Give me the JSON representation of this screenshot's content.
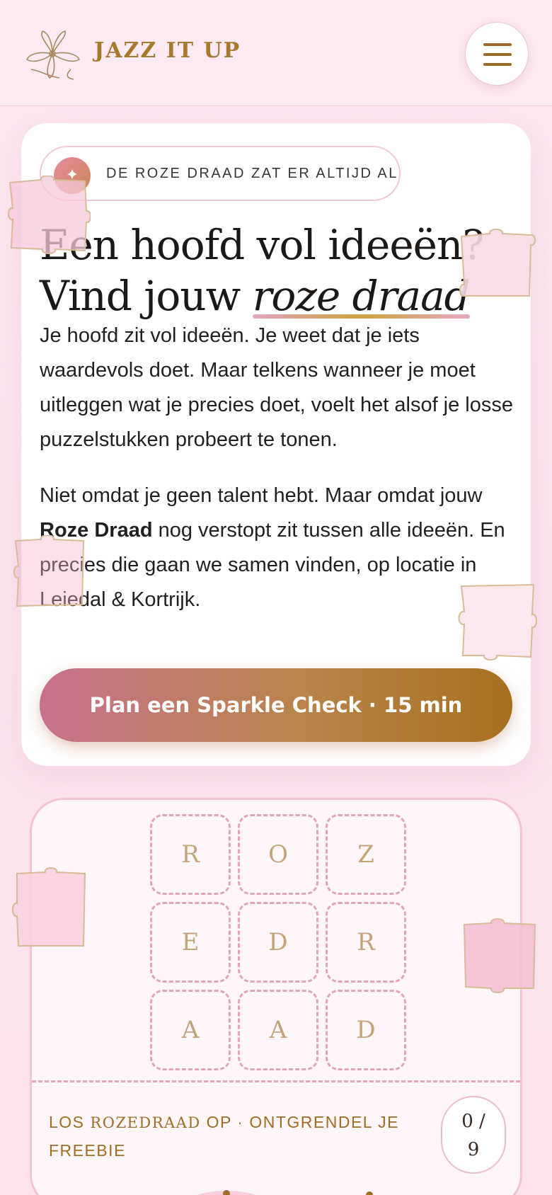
{
  "header": {
    "brand": "JAZZ IT UP",
    "menu_icon": "hamburger-menu-icon",
    "logo_icon": "flower-logo-icon"
  },
  "hero": {
    "pill_icon": "sparkle-icon",
    "pill_text": "DE ROZE DRAAD ZAT ER ALTIJD AL",
    "title_line1": "Een hoofd vol ideeën?",
    "title_line2_plain": "Vind jouw ",
    "title_line2_accent": "roze draad",
    "para1": "Je hoofd zit vol ideeën. Je weet dat je iets waardevols doet. Maar telkens wanneer je moet uitleggen wat je precies doet, voelt het alsof je losse puzzelstukken probeert te tonen.",
    "para2_before": "Niet omdat je geen talent hebt. Maar omdat jouw ",
    "para2_bold": "Roze Draad",
    "para2_after": " nog verstopt zit tussen alle ideeën. En precies die gaan we samen vinden, op locatie in Leiedal & Kortrijk.",
    "cta_label": "Plan een Sparkle Check · 15 min"
  },
  "puzzle": {
    "tiles": [
      "R",
      "O",
      "Z",
      "E",
      "D",
      "R",
      "A",
      "A",
      "D"
    ],
    "unlock_prefix": "LOS ",
    "unlock_word": "ROZEDRAAD",
    "unlock_suffix": " OP · ONTGRENDEL JE FREEBIE",
    "counter_top": "0 /",
    "counter_bottom": "9"
  },
  "colors": {
    "accent_gold": "#a67a2c",
    "accent_pink": "#e3a5bd",
    "cta_start": "#c8718d",
    "cta_end": "#a7701f"
  }
}
